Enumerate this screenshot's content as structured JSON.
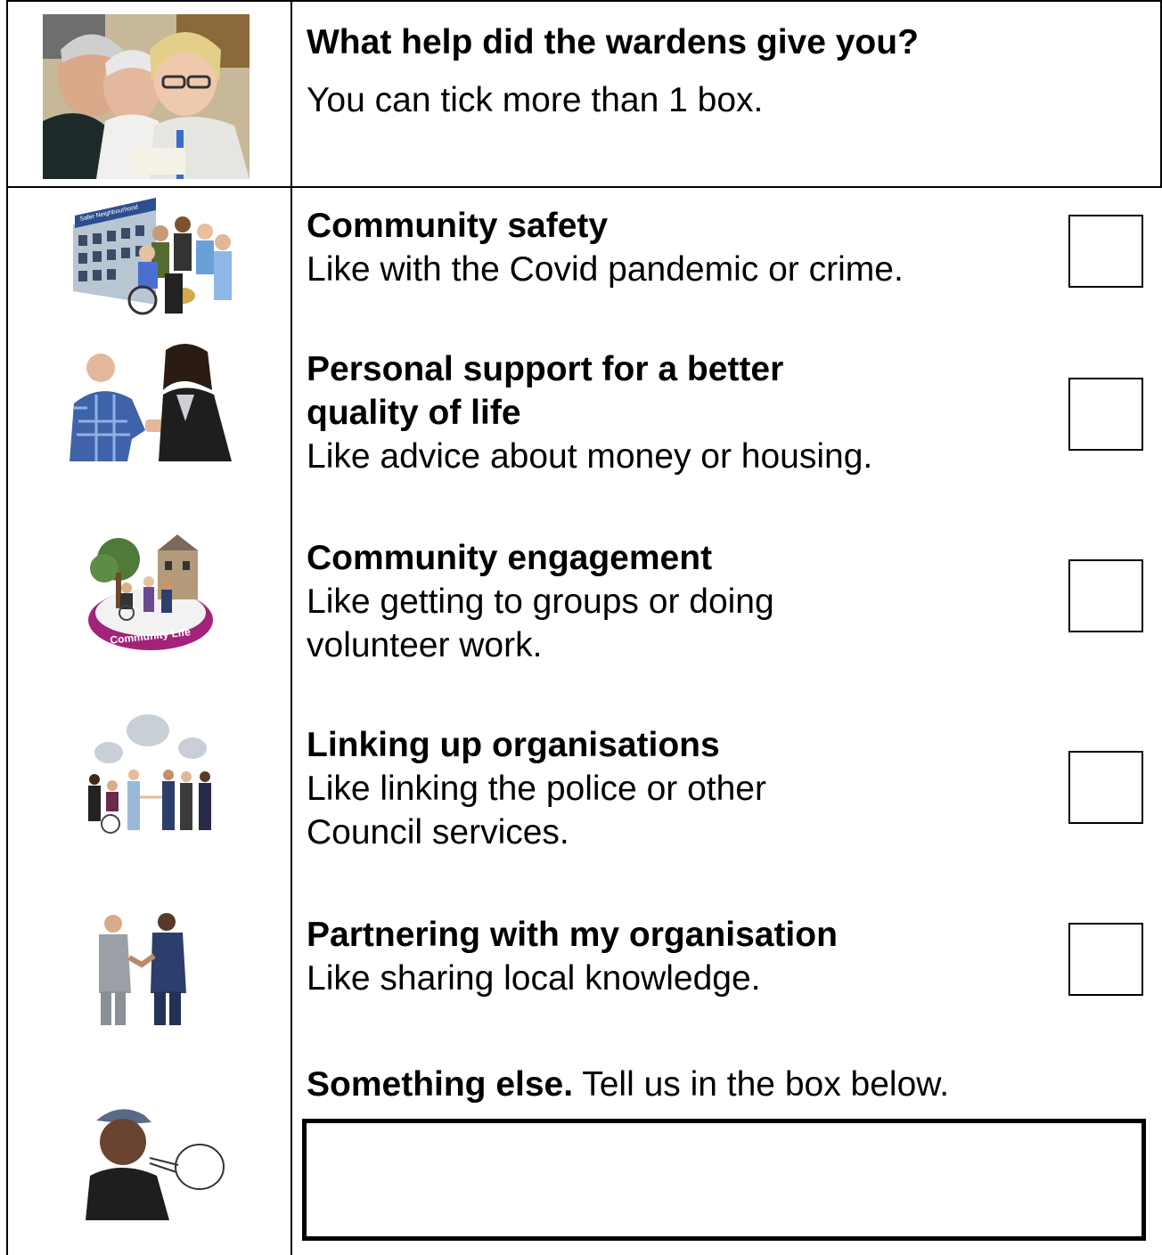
{
  "question": {
    "title": "What help did the wardens give you?",
    "subtitle": "You can tick more than 1 box."
  },
  "options": [
    {
      "title": "Community safety",
      "desc": "Like with the Covid pandemic or crime.",
      "checked": false,
      "icon": "safer-neighbourhood-building-people"
    },
    {
      "title": "Personal support for a better quality of life",
      "desc": "Like advice about money or housing.",
      "checked": false,
      "icon": "two-people-talking"
    },
    {
      "title": "Community engagement",
      "desc": "Like getting to groups or doing volunteer work.",
      "checked": false,
      "icon": "community-life-badge"
    },
    {
      "title": "Linking up organisations",
      "desc": "Like linking the police or other Council services.",
      "checked": false,
      "icon": "group-with-speech-bubbles"
    },
    {
      "title": "Partnering with my organisation",
      "desc": "Like sharing local knowledge.",
      "checked": false,
      "icon": "handshake"
    }
  ],
  "something_else": {
    "title": "Something else.",
    "desc": " Tell us in the box below.",
    "value": "",
    "icon": "person-speaking"
  },
  "header_photo": {
    "icon": "wardens-with-residents-photo"
  },
  "badge_text": "Community Life",
  "building_sign": "Safer Neighbourhood"
}
